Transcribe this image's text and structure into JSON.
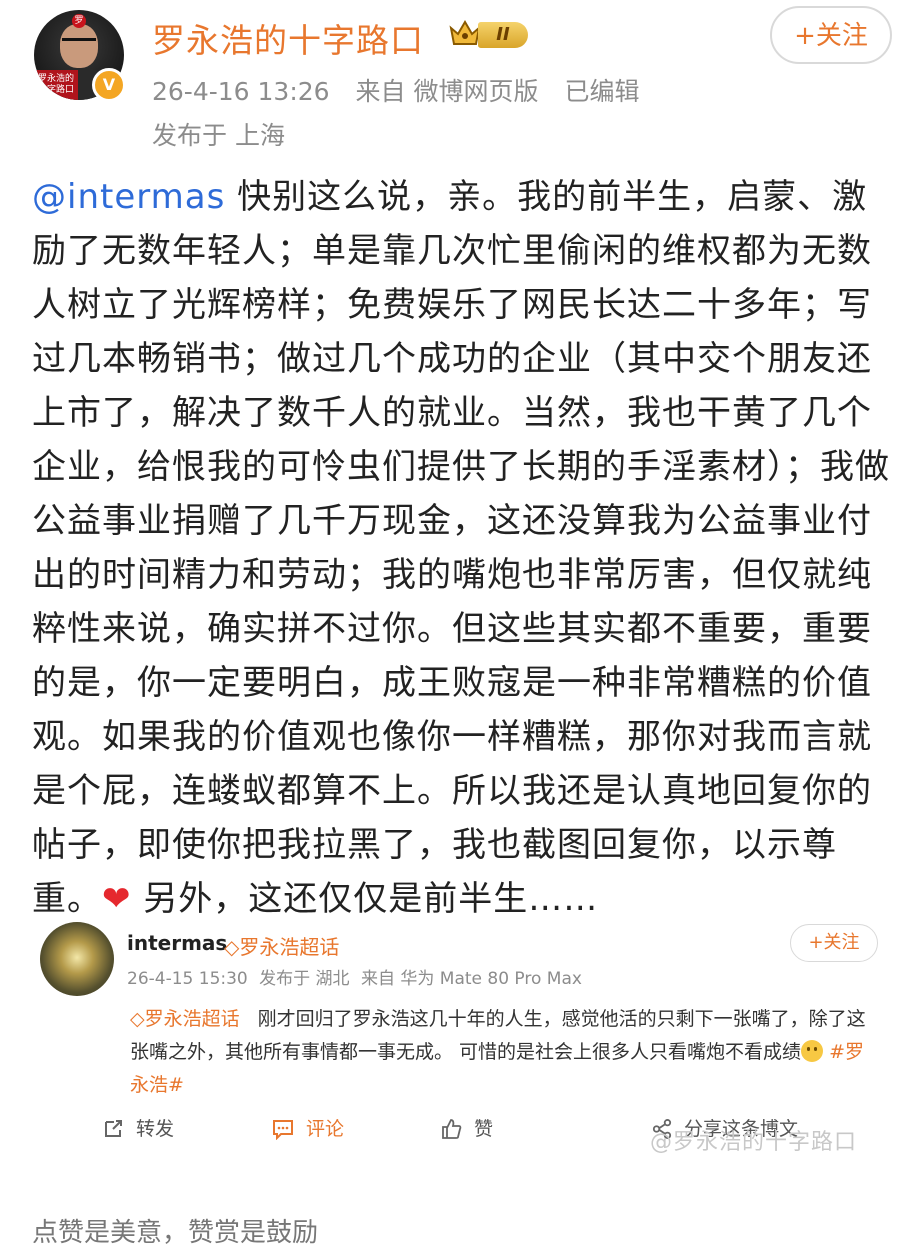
{
  "header": {
    "username": "罗永浩的十字路口",
    "level_badge": "II",
    "avatar_text_top": "罗",
    "avatar_text_label": "罗永浩的十字路口",
    "verified_mark": "V",
    "timestamp": "26-4-16 13:26",
    "source": "来自 微博网页版",
    "edited": "已编辑",
    "location": "发布于 上海",
    "follow_label": "+关注"
  },
  "post": {
    "mention": "@intermas",
    "text_main": " 快别这么说，亲。我的前半生，启蒙、激励了无数年轻人；单是靠几次忙里偷闲的维权都为无数人树立了光辉榜样；免费娱乐了网民长达二十多年；写过几本畅销书；做过几个成功的企业（其中交个朋友还上市了，解决了数千人的就业。当然，我也干黄了几个企业，给恨我的可怜虫们提供了长期的手淫素材）；我做公益事业捐赠了几千万现金，这还没算我为公益事业付出的时间精力和劳动；我的嘴炮也非常厉害，但仅就纯粹性来说，确实拼不过你。但这些其实都不重要，重要的是，你一定要明白，成王败寇是一种非常糟糕的价值观。如果我的价值观也像你一样糟糕，那你对我而言就是个屁，连蝼蚁都算不上。所以我还是认真地回复你的帖子，即使你把我拉黑了，我也截图回复你，以示尊重。",
    "heart": "❤",
    "text_tail": " 另外，这还仅仅是前半生……"
  },
  "quoted": {
    "name": "intermas",
    "topic_badge": "◇罗永浩超话",
    "timestamp": "26-4-15 15:30",
    "location": "发布于 湖北",
    "source": "来自 华为 Mate 80 Pro Max",
    "follow_label": "+关注",
    "topic_inline": "◇罗永浩超话",
    "text": "刚才回归了罗永浩这几十年的人生，感觉他活的只剩下一张嘴了，除了这张嘴之外，其他所有事情都一事无成。 可惜的是社会上很多人只看嘴炮不看成绩",
    "hashtag": "#罗永浩#"
  },
  "actions": {
    "repost": "转发",
    "comment": "评论",
    "like": "赞",
    "share": "分享这条博文"
  },
  "watermark": "@罗永浩的十字路口",
  "footer_note": "点赞是美意，赞赏是鼓励",
  "colors": {
    "accent": "#e8772e",
    "mention": "#2e6bd8",
    "heart": "#e5282e",
    "meta_gray": "#8c8c8c"
  }
}
